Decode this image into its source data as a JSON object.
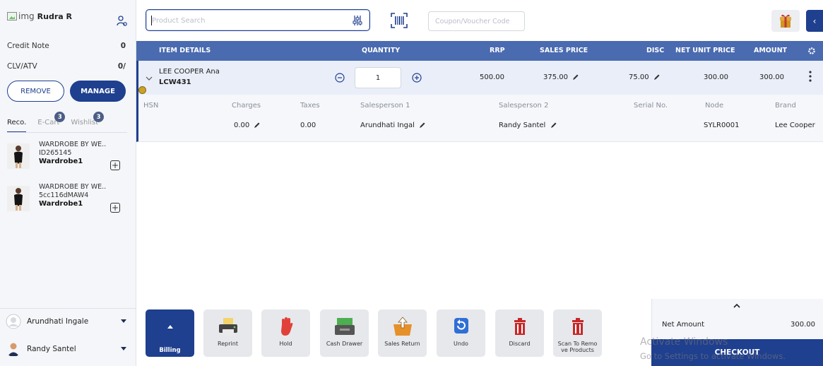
{
  "user": {
    "img_alt": "img",
    "name": "Rudra R"
  },
  "summary": {
    "credit_note_label": "Credit Note",
    "credit_note_value": "0",
    "clv_label": "CLV/ATV",
    "clv_value": "0/"
  },
  "buttons": {
    "remove": "REMOVE",
    "manage": "MANAGE"
  },
  "tabs": [
    {
      "label": "Reco.",
      "badge": ""
    },
    {
      "label": "E-Cart",
      "badge": "3"
    },
    {
      "label": "Wishlist",
      "badge": "3"
    }
  ],
  "recommendations": [
    {
      "brand": "WARDROBE BY WE..",
      "id": "ID265145",
      "name": "Wardrobe1"
    },
    {
      "brand": "WARDROBE BY WE..",
      "id": "5cc116dMAW4",
      "name": "Wardrobe1"
    }
  ],
  "salespersons": [
    {
      "name": "Arundhati Ingale"
    },
    {
      "name": "Randy Santel"
    }
  ],
  "search": {
    "placeholder": "Product Search"
  },
  "coupon": {
    "placeholder": "Coupon/Voucher Code"
  },
  "table": {
    "headers": {
      "item": "ITEM DETAILS",
      "qty": "QUANTITY",
      "rrp": "RRP",
      "sales_price": "SALES PRICE",
      "disc": "DISC",
      "net_unit_price": "NET UNIT PRICE",
      "amount": "AMOUNT"
    },
    "row": {
      "name": "LEE COOPER Ana",
      "code": "LCW431",
      "qty": "1",
      "rrp": "500.00",
      "sales_price": "375.00",
      "disc": "75.00",
      "net_unit_price": "300.00",
      "amount": "300.00"
    },
    "details_labels": {
      "hsn": "HSN",
      "charges": "Charges",
      "taxes": "Taxes",
      "sp1": "Salesperson 1",
      "sp2": "Salesperson 2",
      "serial": "Serial No.",
      "node": "Node",
      "brand": "Brand"
    },
    "details_values": {
      "charges": "0.00",
      "taxes": "0.00",
      "sp1": "Arundhati Ingal",
      "sp2": "Randy Santel",
      "node": "SYLR0001",
      "brand": "Lee Cooper"
    }
  },
  "actions": [
    {
      "label": "Billing",
      "icon": "chevron-up-icon"
    },
    {
      "label": "Reprint",
      "icon": "printer-icon"
    },
    {
      "label": "Hold",
      "icon": "hand-stop-icon"
    },
    {
      "label": "Cash Drawer",
      "icon": "cash-drawer-icon"
    },
    {
      "label": "Sales Return",
      "icon": "return-basket-icon"
    },
    {
      "label": "Undo",
      "icon": "undo-icon"
    },
    {
      "label": "Discard",
      "icon": "trash-icon"
    },
    {
      "label": "Scan To Remo ve Products",
      "icon": "trash-scan-icon"
    }
  ],
  "totals": {
    "net_label": "Net Amount",
    "net_value": "300.00",
    "checkout": "CHECKOUT"
  },
  "watermark": {
    "line1": "Activate Windows",
    "line2": "Go to Settings to activate Windows."
  },
  "colors": {
    "primary": "#1f3f8f",
    "header": "#4a6bb0",
    "row_bg": "#e9eef8"
  }
}
